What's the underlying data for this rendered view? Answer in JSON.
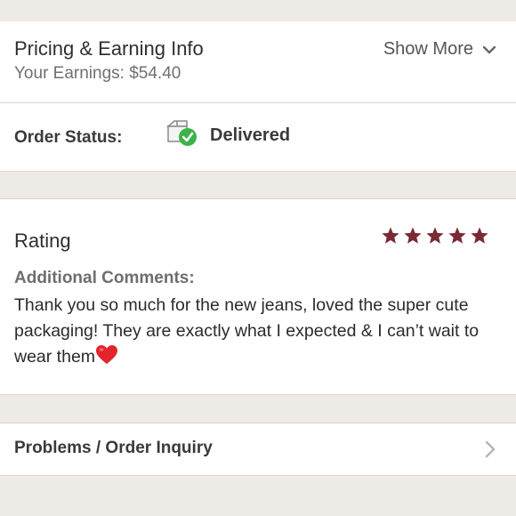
{
  "pricing": {
    "title": "Pricing & Earning Info",
    "earnings": "Your Earnings: $54.40",
    "show_more": "Show More"
  },
  "status": {
    "label": "Order Status:",
    "value": "Delivered",
    "icon": "delivered-box-icon"
  },
  "rating": {
    "title": "Rating",
    "stars": 5,
    "max_stars": 5,
    "star_color": "#7a2a34",
    "comments_label": "Additional Comments:",
    "comment": "Thank you so much for the new jeans, loved the super cute packaging! They are exactly what I expected & I can’t wait to wear them",
    "comment_emoji": "red-heart-emoji"
  },
  "problems": {
    "label": "Problems / Order Inquiry"
  },
  "colors": {
    "background": "#eeebe6",
    "check_green": "#3cb24a"
  }
}
